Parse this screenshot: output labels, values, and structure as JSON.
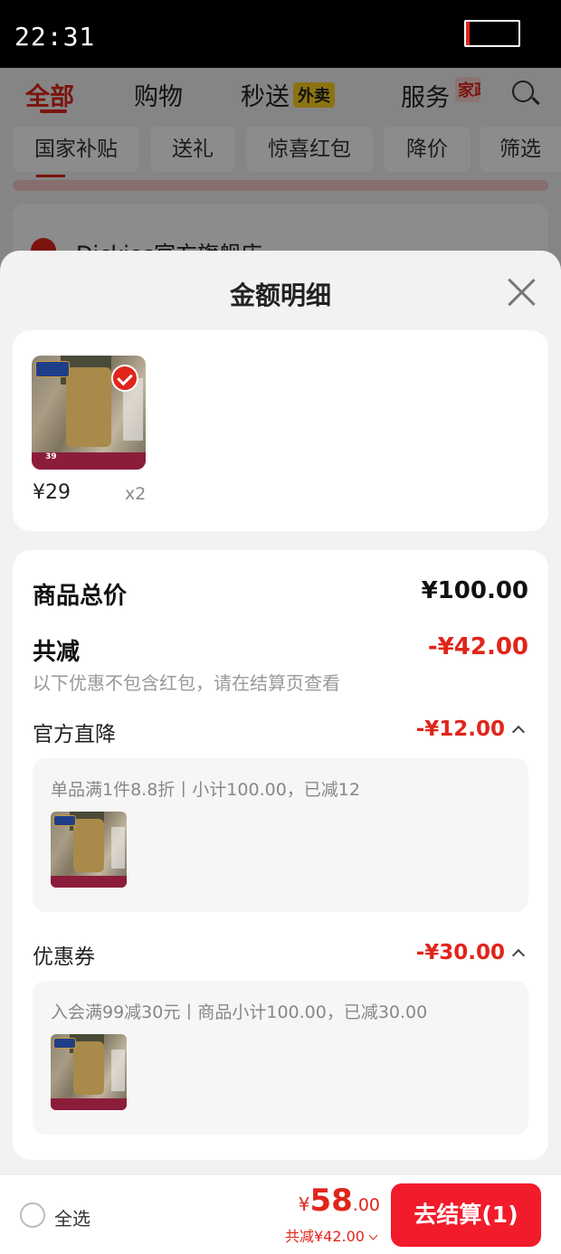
{
  "status_bar": {
    "time": "22:31"
  },
  "background": {
    "tabs": [
      "全部",
      "购物",
      "秒送",
      "服务"
    ],
    "tab_badges": {
      "shopping_speed": "外卖",
      "service": "家政"
    },
    "chips": [
      "国家补贴",
      "送礼",
      "惊喜红包",
      "降价",
      "筛选"
    ],
    "store_name": "Dickies官方旗舰店 ›"
  },
  "sheet": {
    "title": "金额明细",
    "product": {
      "price": "¥29",
      "qty": "x2",
      "img_strip": "39"
    },
    "summary": {
      "total_label": "商品总价",
      "total_value": "¥100.00",
      "reduce_label": "共减",
      "reduce_value": "-¥42.00",
      "note": "以下优惠不包含红包，请在结算页查看"
    },
    "discounts": [
      {
        "label": "官方直降",
        "value": "-¥12.00",
        "detail": "单品满1件8.8折丨小计100.00，已减12"
      },
      {
        "label": "优惠券",
        "value": "-¥30.00",
        "detail": "入会满99减30元丨商品小计100.00，已减30.00"
      }
    ]
  },
  "bottom_bar": {
    "select_all": "全选",
    "currency": "¥",
    "total_int": "58",
    "total_dec": ".00",
    "saved": "共减¥42.00",
    "checkout": "去结算(1)"
  },
  "colors": {
    "accent": "#e0251b",
    "checkout_bg": "#f21b2b"
  }
}
